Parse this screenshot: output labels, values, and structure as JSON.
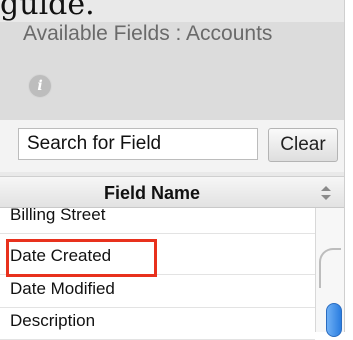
{
  "caption_fragment": "guide.",
  "panel": {
    "title": "Available Fields : Accounts",
    "info_icon": "i"
  },
  "search": {
    "value": "Search for Field",
    "clear_label": "Clear"
  },
  "table": {
    "column_header": "Field Name",
    "rows": [
      "Billing Street",
      "Date Created",
      "Date Modified",
      "Description"
    ],
    "highlighted_row": "Date Created"
  },
  "colors": {
    "highlight_border": "#e8311d",
    "scroll_thumb": "#2a7de0"
  }
}
